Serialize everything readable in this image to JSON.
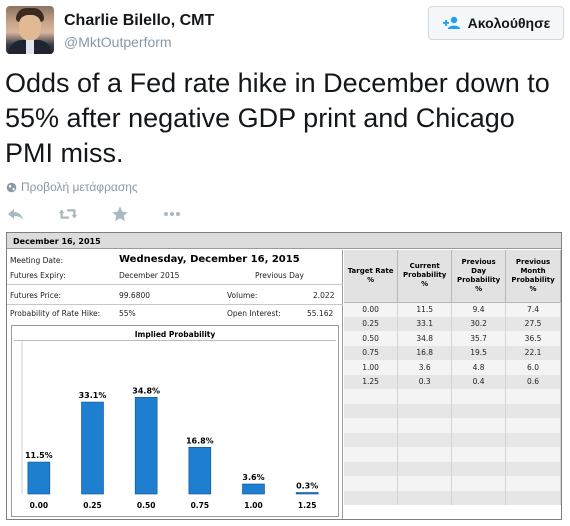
{
  "tweet": {
    "author_name": "Charlie Bilello, CMT",
    "author_handle": "@MktOutperform",
    "follow_label": "Ακολούθησε",
    "text": "Odds of a Fed rate hike in December down to 55% after negative GDP print and Chicago PMI miss.",
    "translate_label": "Προβολή μετάφρασης",
    "icons": [
      "reply-icon",
      "retweet-icon",
      "like-icon",
      "more-icon"
    ]
  },
  "colors": {
    "bar": "#1e7fd0",
    "bar_border": "#0e4f8a",
    "muted": "#8899a6"
  },
  "cme": {
    "header_date": "December 16, 2015",
    "meeting_date_label": "Meeting Date:",
    "meeting_date": "Wednesday, December 16, 2015",
    "futures_expiry_label": "Futures Expiry:",
    "futures_expiry": "December 2015",
    "previous_day_label": "Previous Day",
    "futures_price_label": "Futures Price:",
    "futures_price": "99.6800",
    "volume_label": "Volume:",
    "volume": "2.022",
    "prob_hike_label": "Probability of Rate Hike:",
    "prob_hike": "55%",
    "open_interest_label": "Open Interest:",
    "open_interest": "55.162",
    "table": {
      "headers": [
        "Target Rate %",
        "Current Probability %",
        "Previous Day Probability %",
        "Previous Month Probability %"
      ],
      "rows": [
        [
          "0.00",
          "11.5",
          "9.4",
          "7.4"
        ],
        [
          "0.25",
          "33.1",
          "30.2",
          "27.5"
        ],
        [
          "0.50",
          "34.8",
          "35.7",
          "36.5"
        ],
        [
          "0.75",
          "16.8",
          "19.5",
          "22.1"
        ],
        [
          "1.00",
          "3.6",
          "4.8",
          "6.0"
        ],
        [
          "1.25",
          "0.3",
          "0.4",
          "0.6"
        ]
      ]
    }
  },
  "chart_data": {
    "type": "bar",
    "title": "Implied Probability",
    "categories": [
      "0.00",
      "0.25",
      "0.50",
      "0.75",
      "1.00",
      "1.25"
    ],
    "values": [
      11.5,
      33.1,
      34.8,
      16.8,
      3.6,
      0.3
    ],
    "labels": [
      "11.5%",
      "33.1%",
      "34.8%",
      "16.8%",
      "3.6%",
      "0.3%"
    ],
    "ylim": [
      0,
      100
    ]
  }
}
